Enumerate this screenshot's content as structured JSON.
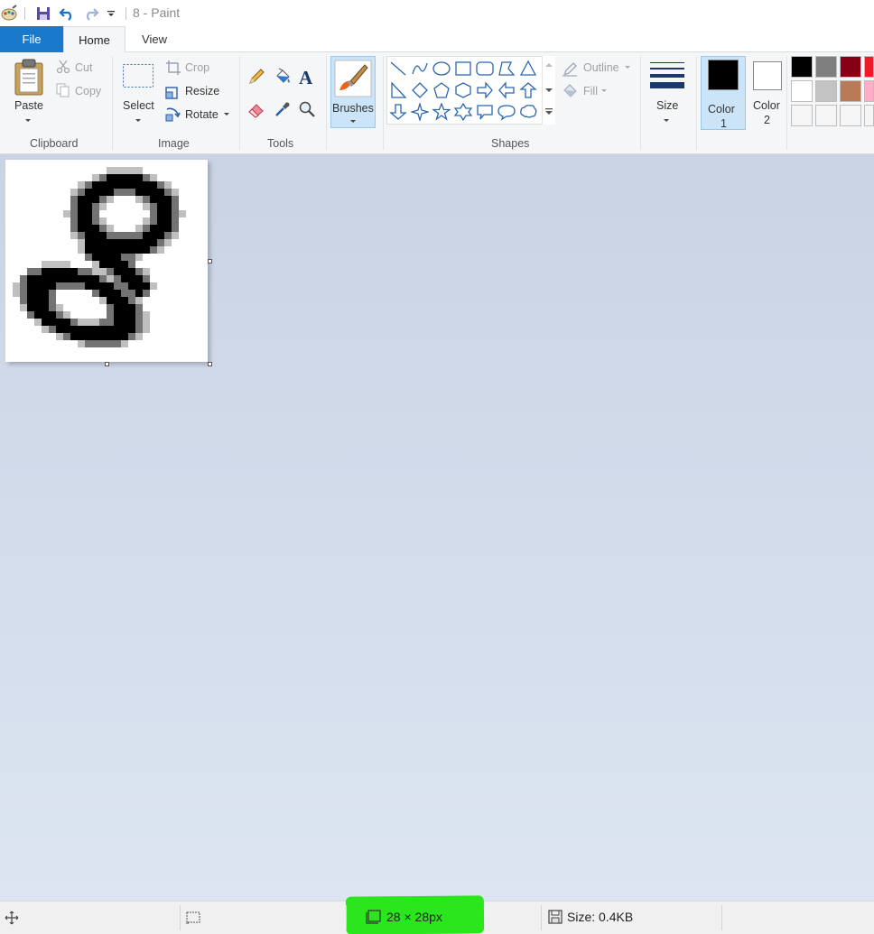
{
  "window": {
    "title": "8 - Paint"
  },
  "tabs": {
    "file": "File",
    "home": "Home",
    "view": "View"
  },
  "clipboard": {
    "paste": "Paste",
    "cut": "Cut",
    "copy": "Copy",
    "group": "Clipboard"
  },
  "image": {
    "select": "Select",
    "crop": "Crop",
    "resize": "Resize",
    "rotate": "Rotate",
    "group": "Image"
  },
  "tools": {
    "group": "Tools"
  },
  "brushes": {
    "label": "Brushes"
  },
  "shapes": {
    "outline": "Outline",
    "fill": "Fill",
    "group": "Shapes"
  },
  "size": {
    "label": "Size"
  },
  "colors": {
    "color1_label": "Color",
    "color1_num": "1",
    "color2_label": "Color",
    "color2_num": "2",
    "color1": "#000000",
    "color2": "#ffffff",
    "palette_row1": [
      "#000000",
      "#7f7f7f",
      "#880015",
      "#ed1c24"
    ],
    "palette_row2": [
      "#ffffff",
      "#c3c3c3",
      "#b97a57",
      "#ffaec9"
    ],
    "palette_row3": [
      "#f5f5f5",
      "#f5f5f5",
      "#f5f5f5",
      "#f5f5f5"
    ]
  },
  "statusbar": {
    "dimensions": "28 × 28px",
    "size": "Size: 0.4KB",
    "highlight_color": "#2be61c"
  },
  "canvas_image": {
    "description_name": "handwritten-digit-8",
    "pixel_grid": "28 × 28px"
  }
}
